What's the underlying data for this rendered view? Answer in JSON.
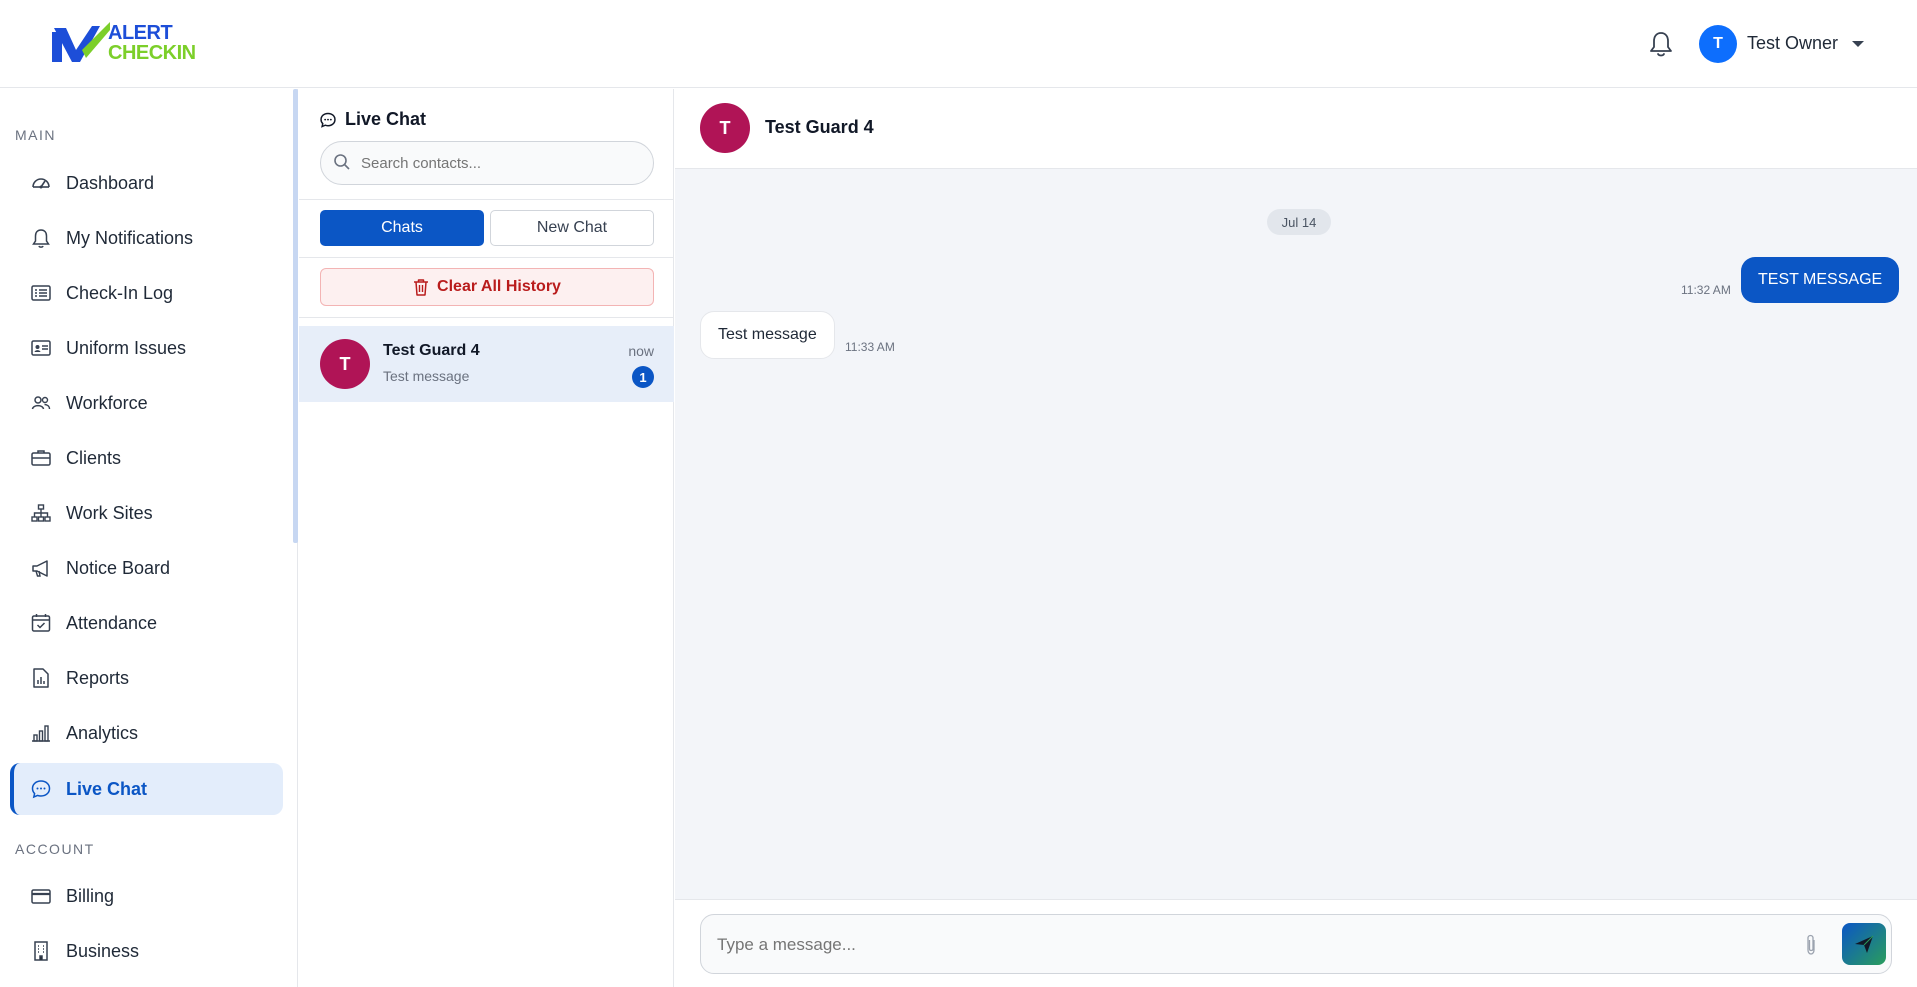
{
  "header": {
    "logo": {
      "line1": "ALERT",
      "line2": "CHECKIN"
    },
    "user": {
      "initial": "T",
      "name": "Test Owner"
    }
  },
  "sidebar": {
    "main_label": "MAIN",
    "account_label": "ACCOUNT",
    "items": [
      {
        "label": "Dashboard",
        "icon": "speedometer-icon"
      },
      {
        "label": "My Notifications",
        "icon": "bell-icon"
      },
      {
        "label": "Check-In Log",
        "icon": "list-check-icon"
      },
      {
        "label": "Uniform Issues",
        "icon": "id-card-icon"
      },
      {
        "label": "Workforce",
        "icon": "people-icon"
      },
      {
        "label": "Clients",
        "icon": "briefcase-icon"
      },
      {
        "label": "Work Sites",
        "icon": "sitemap-icon"
      },
      {
        "label": "Notice Board",
        "icon": "megaphone-icon"
      },
      {
        "label": "Attendance",
        "icon": "calendar-check-icon"
      },
      {
        "label": "Reports",
        "icon": "file-chart-icon"
      },
      {
        "label": "Analytics",
        "icon": "bar-chart-icon"
      },
      {
        "label": "Live Chat",
        "icon": "chat-icon",
        "active": true
      }
    ],
    "account_items": [
      {
        "label": "Billing",
        "icon": "credit-card-icon"
      },
      {
        "label": "Business",
        "icon": "building-icon"
      }
    ]
  },
  "contacts": {
    "title": "Live Chat",
    "search_placeholder": "Search contacts...",
    "tabs": {
      "chats": "Chats",
      "new_chat": "New Chat"
    },
    "clear_label": "Clear All History",
    "list": [
      {
        "initial": "T",
        "name": "Test Guard 4",
        "preview": "Test message",
        "time": "now",
        "unread": "1"
      }
    ]
  },
  "chat": {
    "contact_initial": "T",
    "contact_name": "Test Guard 4",
    "date_label": "Jul 14",
    "messages": [
      {
        "direction": "out",
        "text": "TEST MESSAGE",
        "time": "11:32 AM"
      },
      {
        "direction": "in",
        "text": "Test message",
        "time": "11:33 AM"
      }
    ],
    "composer_placeholder": "Type a message..."
  },
  "colors": {
    "primary": "#0b56c5",
    "avatar_user": "#0d6efd",
    "avatar_contact": "#b01456",
    "danger": "#b91c1c",
    "logo_green": "#7ccf2a"
  }
}
